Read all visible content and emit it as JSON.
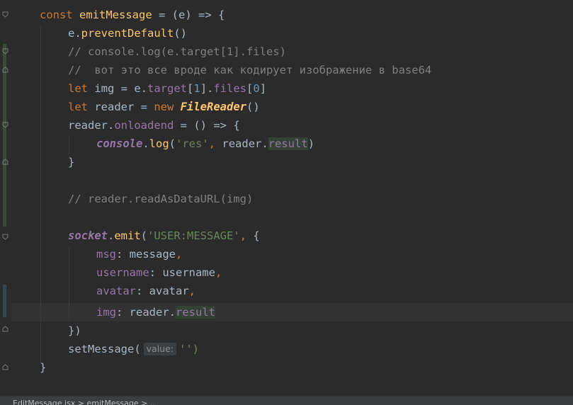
{
  "colors": {
    "background": "#2b2b2b",
    "keyword": "#cc7832",
    "function": "#ffc66d",
    "property": "#9876aa",
    "number": "#6897bb",
    "string": "#6a8759",
    "comment": "#808080",
    "text": "#a9b7c6",
    "usage_highlight": "#344134",
    "caret_line": "#323232"
  },
  "code": {
    "l1": {
      "t1": "const",
      "t2": "emitMessage",
      "t3": " = (e) => {"
    },
    "l2": {
      "t1": "e.",
      "t2": "preventDefault",
      "t3": "()"
    },
    "l3": {
      "t1": "// console.log(e.target[1].files)"
    },
    "l4": {
      "t1": "//  вот это все вроде как кодирует изображение в base64"
    },
    "l5": {
      "t1": "let",
      "t2": " img = e.",
      "t3": "target",
      "t4": "[",
      "t5": "1",
      "t6": "].",
      "t7": "files",
      "t8": "[",
      "t9": "0",
      "t10": "]"
    },
    "l6": {
      "t1": "let",
      "t2": " reader = ",
      "t3": "new",
      "t4": "FileReader",
      "t5": "()"
    },
    "l7": {
      "t1": "reader.",
      "t2": "onloadend",
      "t3": " = () => {"
    },
    "l8": {
      "t1": "console",
      "t2": ".",
      "t3": "log",
      "t4": "(",
      "t5": "'res'",
      "t6": ",",
      "t7": " reader.",
      "t8": "result",
      "t9": ")"
    },
    "l9": {
      "t1": "}"
    },
    "l11": {
      "t1": "// reader.readAsDataURL(img)"
    },
    "l13": {
      "t1": "socket",
      "t2": ".",
      "t3": "emit",
      "t4": "(",
      "t5": "'USER:MESSAGE'",
      "t6": ",",
      "t7": " {"
    },
    "l14": {
      "t1": "msg",
      "t2": ": message",
      "t3": ","
    },
    "l15": {
      "t1": "username",
      "t2": ": username",
      "t3": ","
    },
    "l16": {
      "t1": "avatar",
      "t2": ": avatar",
      "t3": ","
    },
    "l17": {
      "t1": "img",
      "t2": ": reader.",
      "t3": "result"
    },
    "l18": {
      "t1": "})"
    },
    "l19": {
      "t1": "setMessage(",
      "t2": "value:",
      "t3": "'')"
    },
    "l20": {
      "t1": "}"
    }
  },
  "statusbar": {
    "text": "EditMessage.jsx  >  emitMessage  >  ..."
  }
}
